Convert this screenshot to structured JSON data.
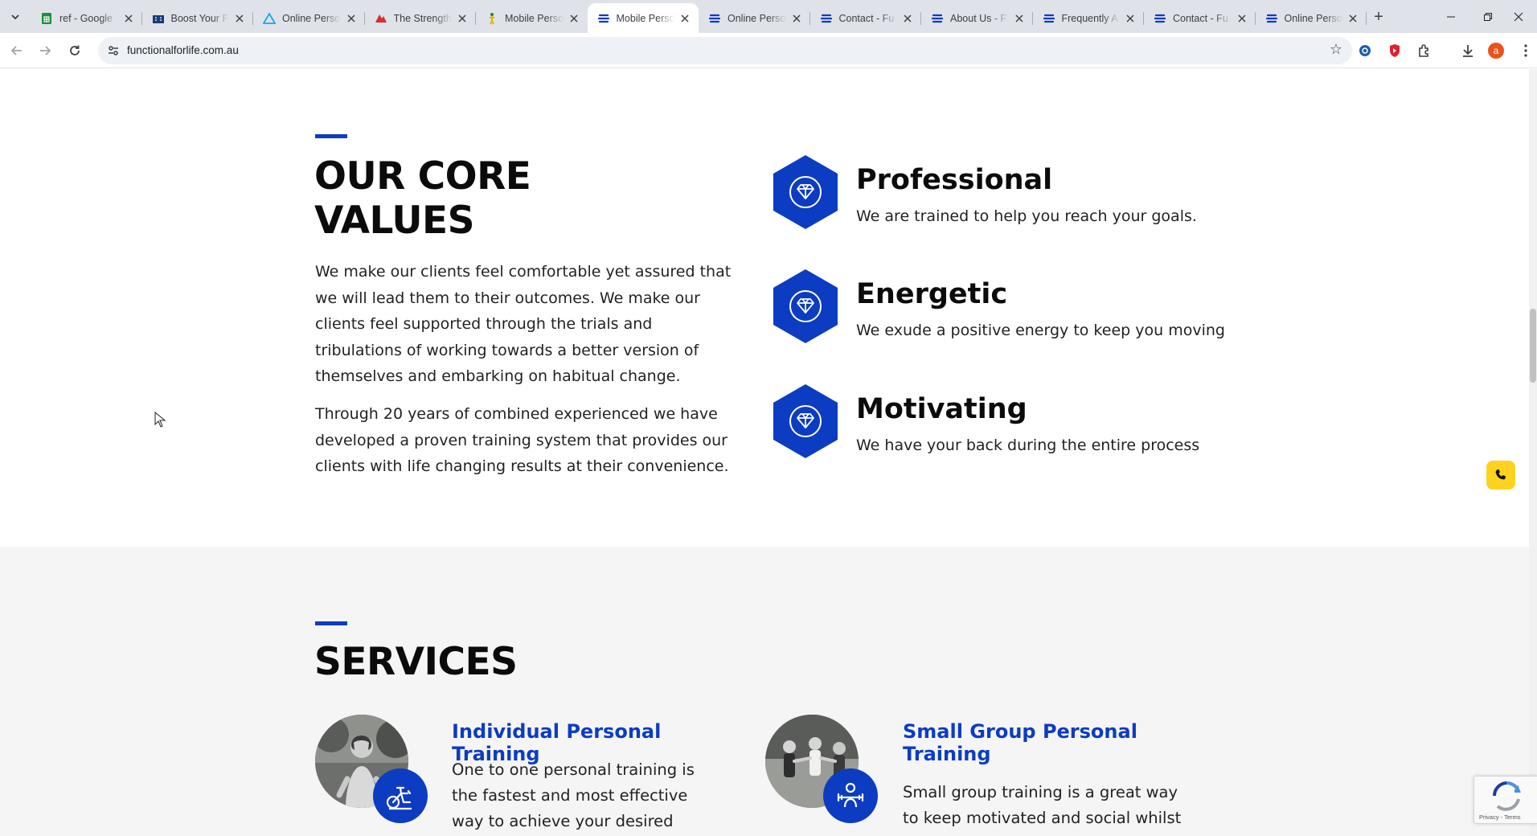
{
  "browser": {
    "tabs": [
      {
        "title": "ref - Google",
        "icon": "google-sheets-icon",
        "color": "#1e8e3e"
      },
      {
        "title": "Boost Your F",
        "icon": "building-icon",
        "color": "#1a3b7a"
      },
      {
        "title": "Online Perso",
        "icon": "triangle-logo-icon",
        "color": "#1aa7ec"
      },
      {
        "title": "The Strength",
        "icon": "strength-logo-icon",
        "color": "#d32f2f"
      },
      {
        "title": "Mobile Perso",
        "icon": "figure-logo-icon",
        "color": "#e8b400"
      },
      {
        "title": "Mobile Perso",
        "icon": "site-logo-icon",
        "color": "#0c3cc1",
        "active": true
      },
      {
        "title": "Online Perso",
        "icon": "site-logo-icon",
        "color": "#0c3cc1"
      },
      {
        "title": "Contact - Fu",
        "icon": "site-logo-icon",
        "color": "#0c3cc1"
      },
      {
        "title": "About Us - F",
        "icon": "site-logo-icon",
        "color": "#0c3cc1"
      },
      {
        "title": "Frequently A",
        "icon": "site-logo-icon",
        "color": "#0c3cc1"
      },
      {
        "title": "Contact - Fu",
        "icon": "site-logo-icon",
        "color": "#0c3cc1"
      },
      {
        "title": "Online Perso",
        "icon": "site-logo-icon",
        "color": "#0c3cc1"
      }
    ],
    "url": "functionalforlife.com.au",
    "profile_initial": "a"
  },
  "core_values": {
    "heading_line1": "OUR CORE",
    "heading_line2": "VALUES",
    "paragraph1": "We make our clients feel comfortable yet assured that we will lead them to their outcomes. We make our clients feel supported through the trials and tribulations of working towards a better version of themselves and embarking on habitual change.",
    "paragraph2": "Through 20 years of combined experienced we have developed a proven training system that provides our clients with life changing results at their convenience.",
    "items": [
      {
        "title": "Professional",
        "description": "We are trained to help you reach your goals.",
        "icon": "diamond-icon"
      },
      {
        "title": "Energetic",
        "description": "We exude a positive energy to keep you moving",
        "icon": "diamond-icon"
      },
      {
        "title": "Motivating",
        "description": "We have your back during the entire process",
        "icon": "diamond-icon"
      }
    ]
  },
  "services": {
    "heading": "SERVICES",
    "items": [
      {
        "title": "Individual Personal Training",
        "description": "One to one personal training is the fastest and most effective way to achieve your desired health goals.",
        "icon": "exercise-bike-icon"
      },
      {
        "title": "Small Group Personal Training",
        "description": "Small group training is a great way to keep motivated and social whilst still",
        "icon": "group-training-icon"
      }
    ]
  },
  "widgets": {
    "recaptcha_terms": "Privacy - Terms"
  },
  "colors": {
    "brand_blue": "#0c3cc1",
    "call_yellow": "#ffd21f",
    "services_bg": "#f5f5f5"
  }
}
